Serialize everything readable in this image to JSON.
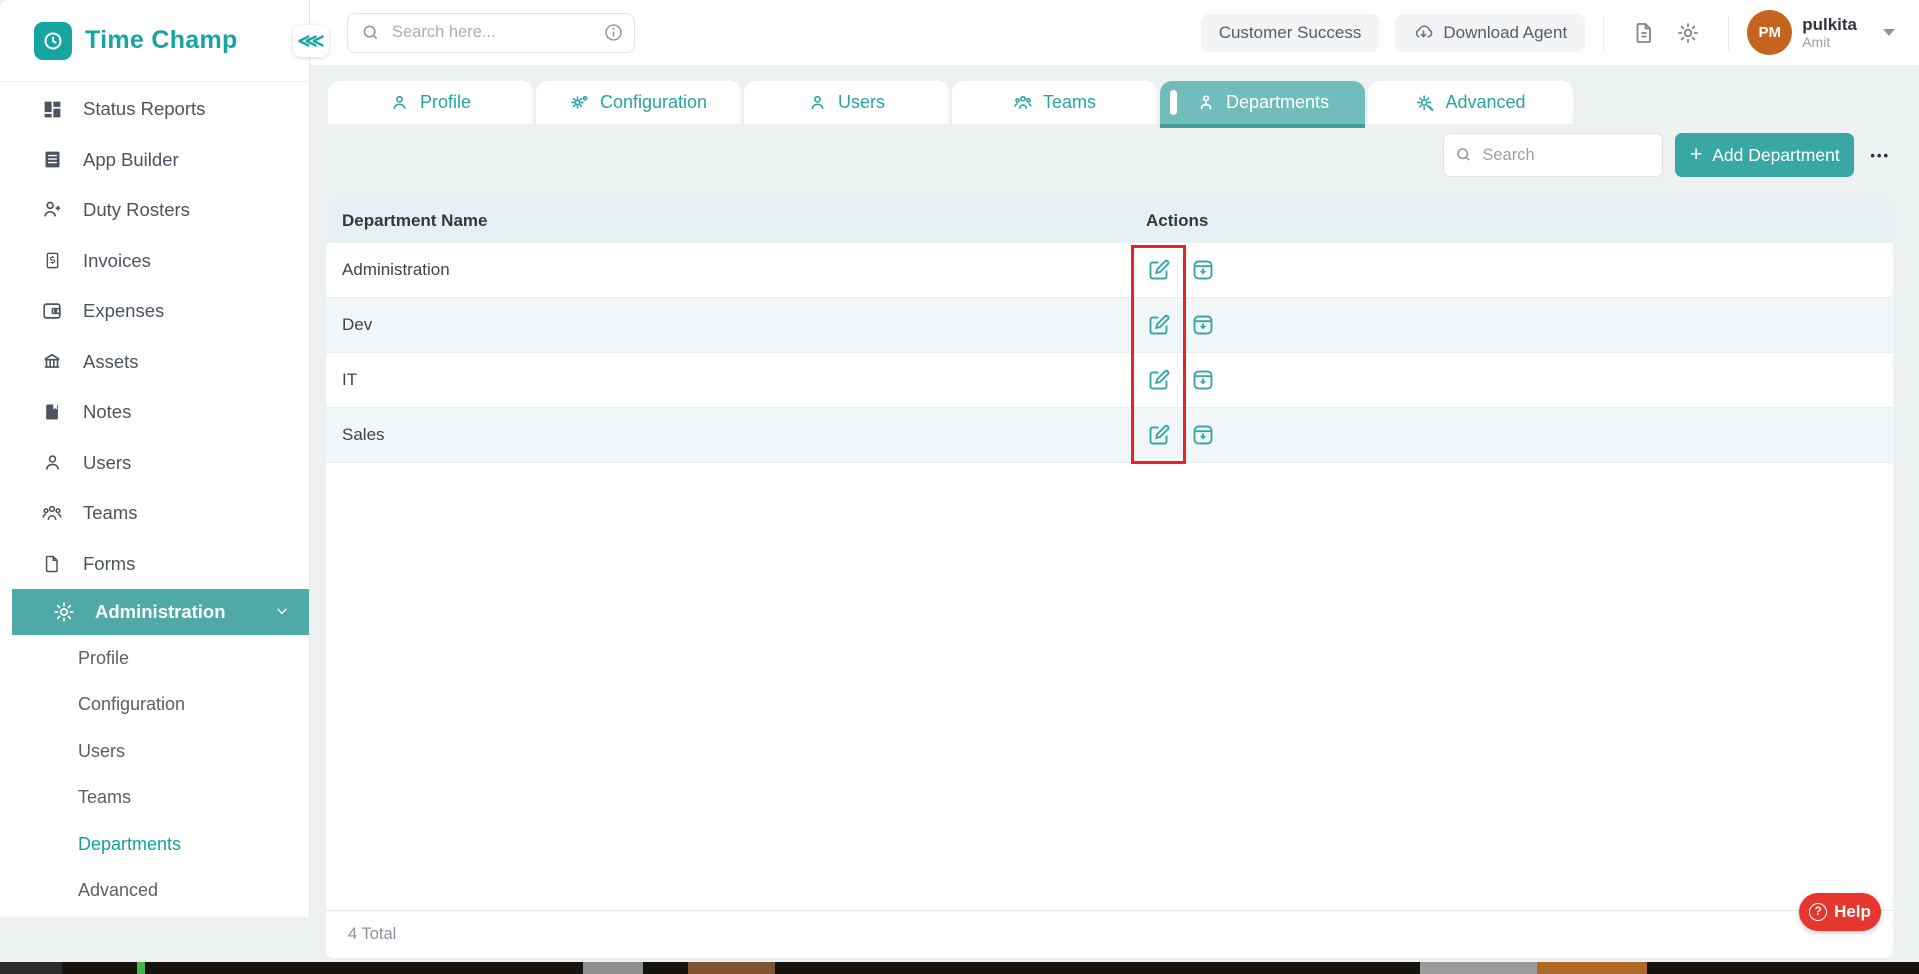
{
  "brand": {
    "name": "Time Champ"
  },
  "sidebar": {
    "items": [
      {
        "label": "Status Reports",
        "icon": "dashboard-icon"
      },
      {
        "label": "App Builder",
        "icon": "app-builder-icon"
      },
      {
        "label": "Duty Rosters",
        "icon": "person-add-icon"
      },
      {
        "label": "Invoices",
        "icon": "invoice-icon"
      },
      {
        "label": "Expenses",
        "icon": "wallet-icon"
      },
      {
        "label": "Assets",
        "icon": "bank-icon"
      },
      {
        "label": "Notes",
        "icon": "notebook-icon"
      },
      {
        "label": "Users",
        "icon": "user-icon"
      },
      {
        "label": "Teams",
        "icon": "team-icon"
      },
      {
        "label": "Forms",
        "icon": "file-icon"
      },
      {
        "label": "Administration",
        "icon": "gear-icon",
        "active": true
      }
    ],
    "admin_subitems": [
      {
        "label": "Profile"
      },
      {
        "label": "Configuration"
      },
      {
        "label": "Users"
      },
      {
        "label": "Teams"
      },
      {
        "label": "Departments",
        "active": true
      },
      {
        "label": "Advanced"
      }
    ]
  },
  "topbar": {
    "search_placeholder": "Search here...",
    "customer_success_label": "Customer Success",
    "download_agent_label": "Download Agent",
    "user": {
      "initials": "PM",
      "name": "pulkita",
      "company": "Amit"
    }
  },
  "icons": {
    "collapse": "⋘",
    "ellipsis": "•••"
  },
  "tabs": [
    {
      "label": "Profile",
      "icon": "person-icon"
    },
    {
      "label": "Configuration",
      "icon": "gears-icon"
    },
    {
      "label": "Users",
      "icon": "person-icon"
    },
    {
      "label": "Teams",
      "icon": "group-icon"
    },
    {
      "label": "Departments",
      "icon": "department-icon",
      "active": true
    },
    {
      "label": "Advanced",
      "icon": "gear-wrench-icon"
    }
  ],
  "toolbar": {
    "search_placeholder": "Search",
    "add_plus": "+",
    "add_button_label": "Add Department"
  },
  "table": {
    "columns": [
      "Department Name",
      "Actions"
    ],
    "rows": [
      {
        "name": "Administration"
      },
      {
        "name": "Dev"
      },
      {
        "name": "IT"
      },
      {
        "name": "Sales"
      }
    ]
  },
  "footer": {
    "total": "4 Total"
  },
  "help": {
    "label": "Help"
  },
  "colors": {
    "accent_teal": "#16a5a1",
    "active_item_bg": "#4fa9a6",
    "active_tab_bg": "#70bdbb",
    "tab_underline": "#419d9a",
    "add_button": "#39a7a4",
    "table_header_bg": "#e7f0f3",
    "alt_row_bg": "#f1f7f8",
    "highlight_red": "#ee2020",
    "help_red": "#e6362e",
    "avatar_orange": "#c4641f"
  }
}
